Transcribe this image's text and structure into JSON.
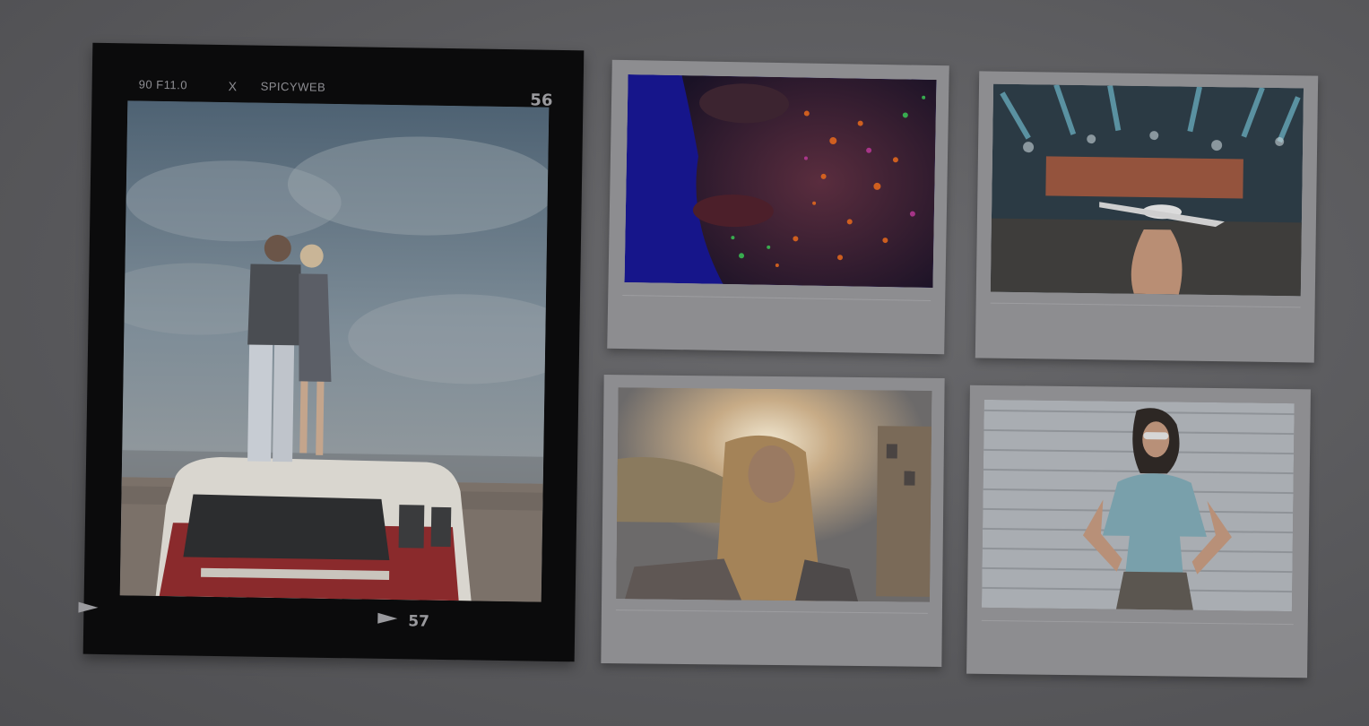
{
  "film_frame": {
    "meta_left": "90 F11.0",
    "meta_mid": "X",
    "meta_brand": "SPICYWEB",
    "frame_number_top": "56",
    "frame_number_bottom": "57"
  },
  "colors": {
    "background": "#5c5c5f",
    "film": "#0b0b0c",
    "polaroid_paper": "#8d8d90",
    "film_text": "#8e8e93"
  }
}
